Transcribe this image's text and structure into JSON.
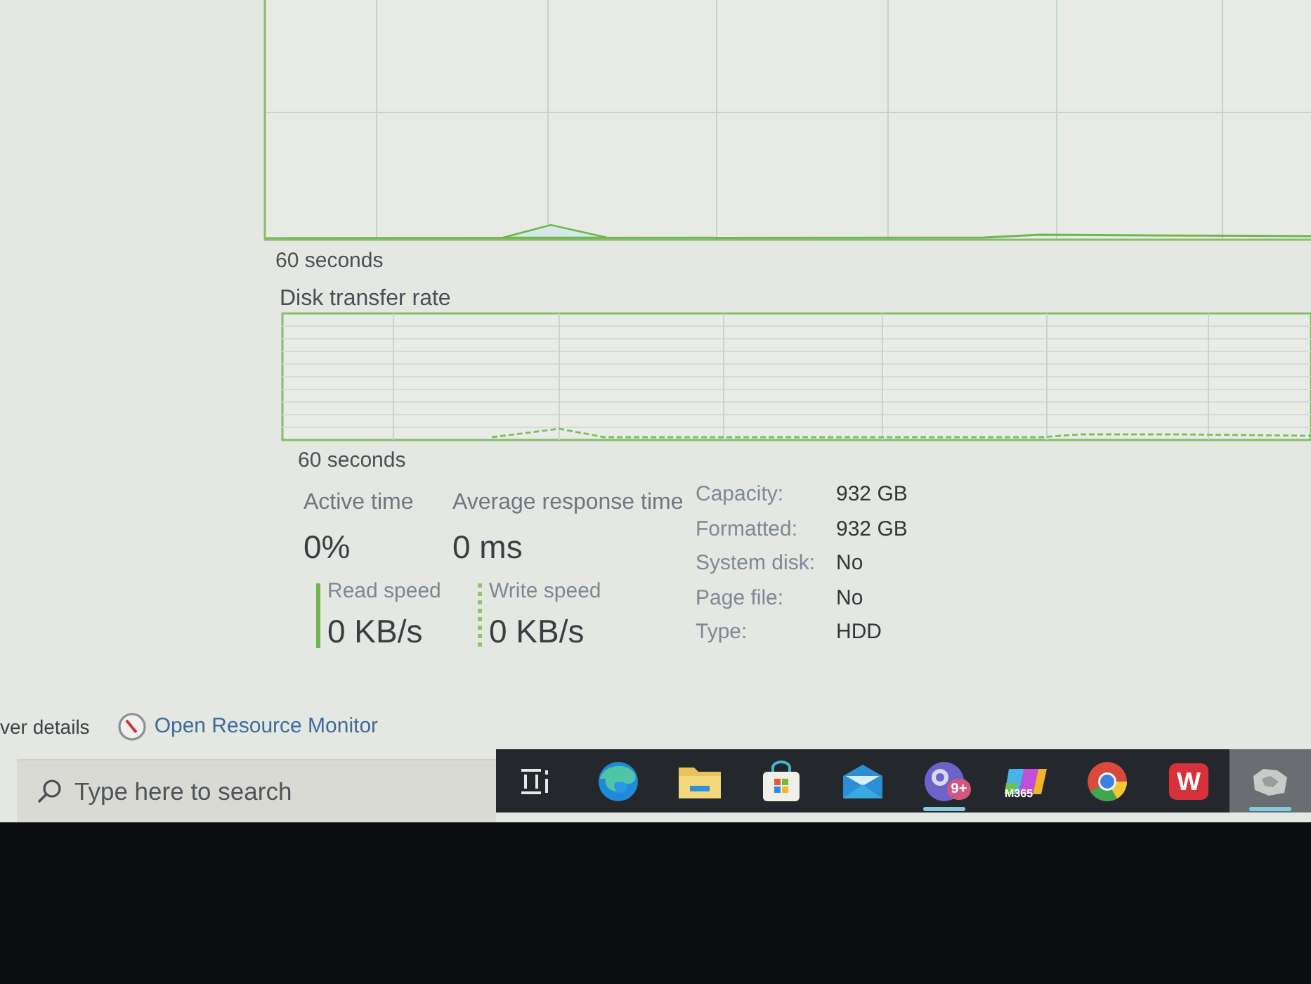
{
  "upper_graph": {
    "caption": "60 seconds"
  },
  "transfer_graph": {
    "title": "Disk transfer rate",
    "caption": "60 seconds"
  },
  "stats": [
    {
      "label": "Active time",
      "value": "0%"
    },
    {
      "label": "Average response time",
      "value": "0 ms"
    }
  ],
  "speeds": [
    {
      "kind": "solid",
      "label": "Read speed",
      "value": "0 KB/s"
    },
    {
      "kind": "dotted",
      "label": "Write speed",
      "value": "0 KB/s"
    }
  ],
  "properties": [
    {
      "label": "Capacity:",
      "value": "932 GB"
    },
    {
      "label": "Formatted:",
      "value": "932 GB"
    },
    {
      "label": "System disk:",
      "value": "No"
    },
    {
      "label": "Page file:",
      "value": "No"
    },
    {
      "label": "Type:",
      "value": "HDD"
    }
  ],
  "footer": {
    "details_link": "ver details",
    "resource_monitor_link": "Open Resource Monitor"
  },
  "taskbar": {
    "search": {
      "placeholder": "Type here to search"
    },
    "apps": [
      {
        "kind": "task_view",
        "running": false,
        "selected": false
      },
      {
        "kind": "swirl",
        "running": false,
        "selected": false
      },
      {
        "kind": "folder",
        "running": false,
        "selected": false
      },
      {
        "kind": "bag",
        "running": false,
        "selected": false
      },
      {
        "kind": "mail",
        "running": false,
        "selected": false
      },
      {
        "kind": "round_app",
        "badge": "9+",
        "running": true,
        "selected": false
      },
      {
        "kind": "tiles",
        "label": "M365",
        "running": false,
        "selected": false
      },
      {
        "kind": "ring",
        "running": false,
        "selected": false
      },
      {
        "kind": "w_logo",
        "label": "W",
        "running": false,
        "selected": false
      },
      {
        "kind": "grey_tile",
        "running": true,
        "selected": true
      }
    ]
  }
}
